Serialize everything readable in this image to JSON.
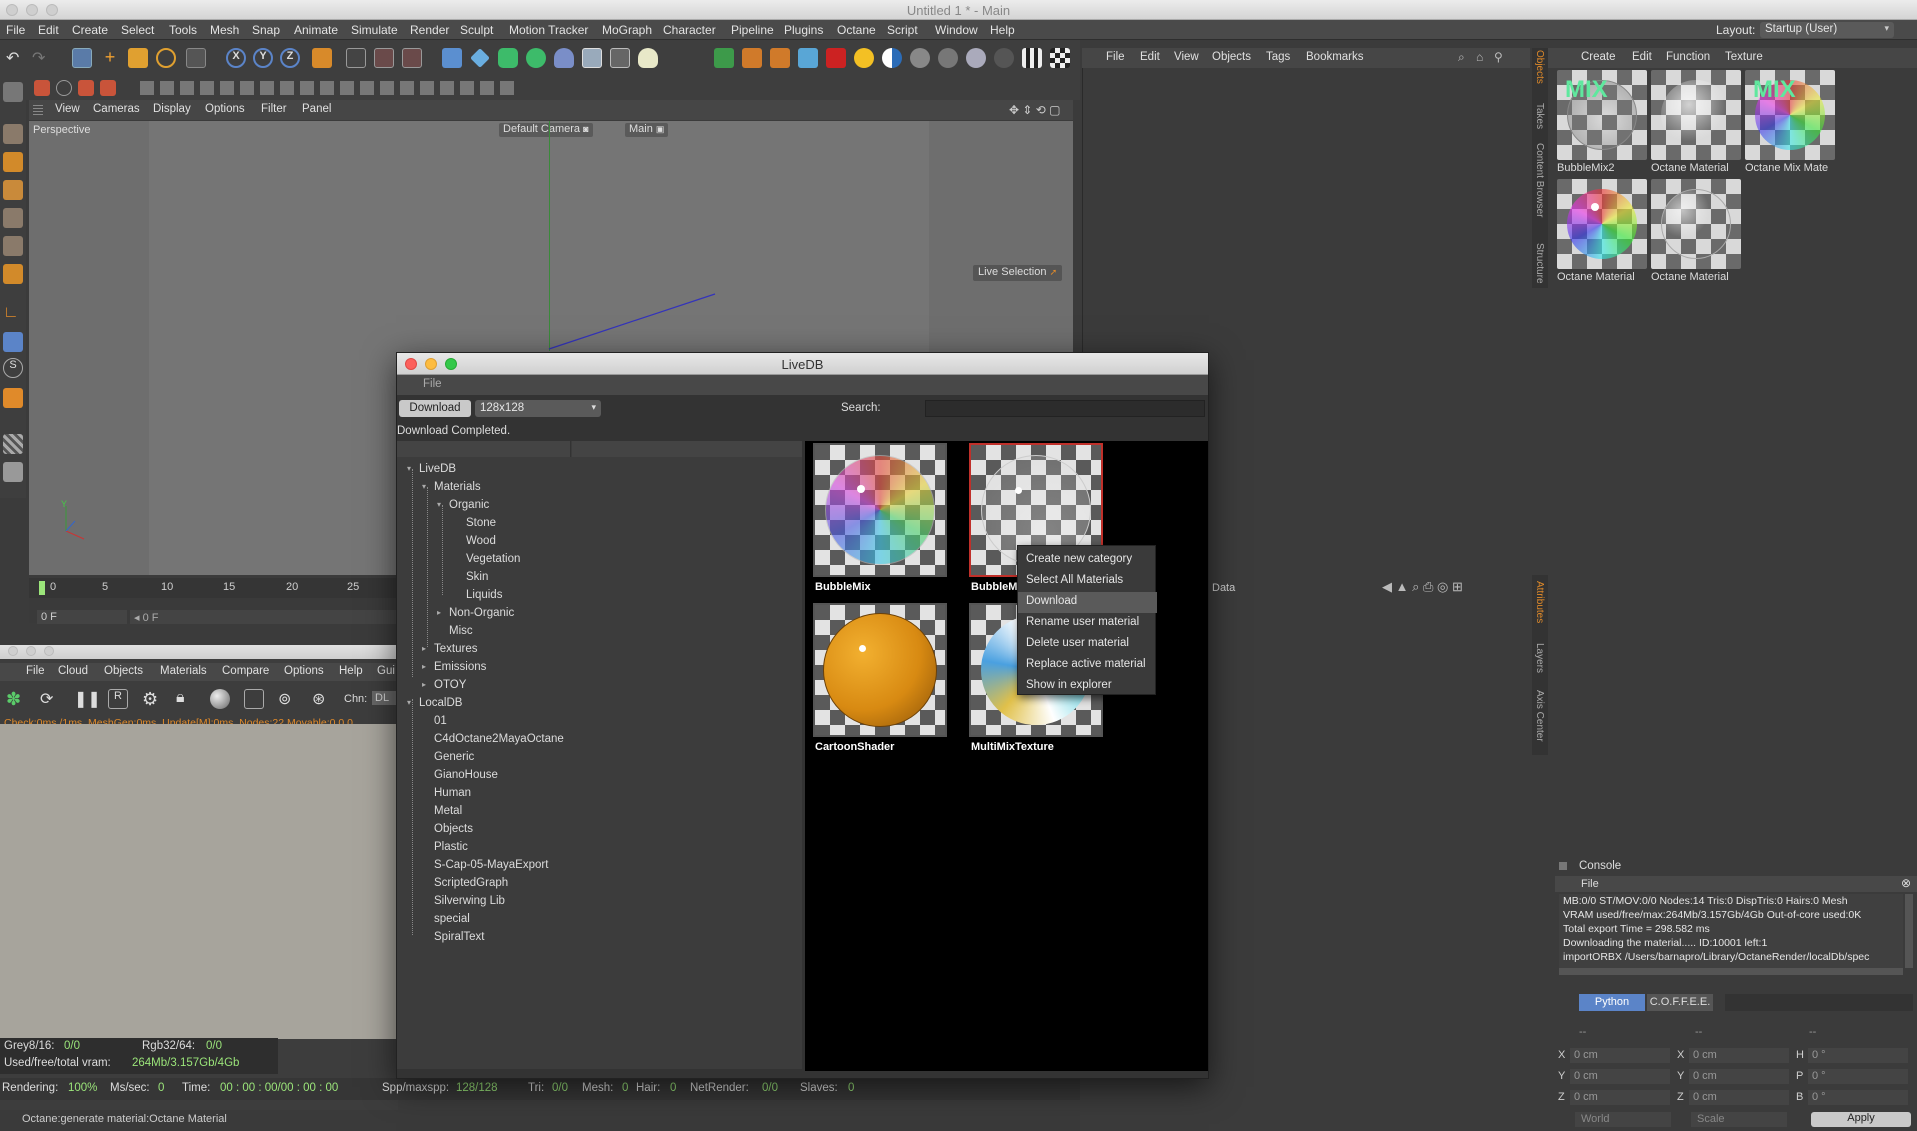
{
  "window": {
    "title": "Untitled 1 * - Main"
  },
  "menubar": [
    "File",
    "Edit",
    "Create",
    "Select",
    "Tools",
    "Mesh",
    "Snap",
    "Animate",
    "Simulate",
    "Render",
    "Sculpt",
    "Motion Tracker",
    "MoGraph",
    "Character",
    "Pipeline",
    "Plugins",
    "Octane",
    "Script",
    "Window",
    "Help"
  ],
  "layout": {
    "label": "Layout:",
    "value": "Startup (User)"
  },
  "viewport": {
    "menu": [
      "View",
      "Cameras",
      "Display",
      "Options",
      "Filter",
      "Panel"
    ],
    "perspective_label": "Perspective",
    "camera_label": "Default Camera",
    "main_label": "Main",
    "live_selection": "Live Selection"
  },
  "timeline": {
    "ticks": [
      "0",
      "5",
      "10",
      "15",
      "20",
      "25"
    ],
    "frame_value": "0 F",
    "frame_field2": "0 F",
    "texture_label": "Texture"
  },
  "object_manager": {
    "menu": [
      "File",
      "Edit",
      "View",
      "Objects",
      "Tags",
      "Bookmarks"
    ],
    "side_tabs": [
      "Objects",
      "Takes",
      "Content Browser",
      "Structure"
    ]
  },
  "material_manager": {
    "menu": [
      "Create",
      "Edit",
      "Function",
      "Texture"
    ],
    "materials": [
      {
        "name": "BubbleMix2",
        "mix": "MIX"
      },
      {
        "name": "Octane Material",
        "mix": ""
      },
      {
        "name": "Octane Mix Mate",
        "mix": "MIX"
      },
      {
        "name": "Octane Material",
        "mix": ""
      },
      {
        "name": "Octane Material",
        "mix": ""
      }
    ]
  },
  "attributes": {
    "data_label": "Data",
    "side_tabs": [
      "Attributes",
      "Layers",
      "Axis Center"
    ]
  },
  "console": {
    "title": "Console",
    "file_menu": "File",
    "lines": [
      "MB:0/0  ST/MOV:0/0  Nodes:14  Tris:0  DispTris:0  Hairs:0  Mesh",
      "VRAM used/free/max:264Mb/3.157Gb/4Gb  Out-of-core used:0K",
      "Total export Time = 298.582 ms",
      "Downloading the material..... ID:10001 left:1",
      "importORBX /Users/barnapro/Library/OctaneRender/localDb/spec"
    ],
    "tabs": [
      "Python",
      "C.O.F.F.E.E."
    ]
  },
  "coords": {
    "headers": [
      "--",
      "--",
      "--"
    ],
    "rows": [
      {
        "a": "X",
        "av": "0 cm",
        "b": "X",
        "bv": "0 cm",
        "c": "H",
        "cv": "0 °"
      },
      {
        "a": "Y",
        "av": "0 cm",
        "b": "Y",
        "bv": "0 cm",
        "c": "P",
        "cv": "0 °"
      },
      {
        "a": "Z",
        "av": "0 cm",
        "b": "Z",
        "bv": "0 cm",
        "c": "B",
        "cv": "0 °"
      }
    ],
    "world": "World",
    "scale": "Scale",
    "apply": "Apply"
  },
  "octane_window": {
    "menu": [
      "File",
      "Cloud",
      "Objects",
      "Materials",
      "Compare",
      "Options",
      "Help",
      "Gui"
    ],
    "chn_label": "Chn:",
    "chn_value": "DL",
    "status_line": "Check:0ms./1ms. MeshGen:0ms. Update[M]:0ms. Nodes:22 Movable:0  0 0",
    "grey_label": "Grey8/16:",
    "grey_value": "0/0",
    "rgb_label": "Rgb32/64:",
    "rgb_value": "0/0",
    "vram_label": "Used/free/total vram:",
    "vram_value": "264Mb/3.157Gb/4Gb"
  },
  "render_status": {
    "rendering_label": "Rendering:",
    "rendering_value": "100%",
    "ms_label": "Ms/sec:",
    "ms_value": "0",
    "time_label": "Time:",
    "time_value": "00 : 00 : 00/00 : 00 : 00",
    "spp_label": "Spp/maxspp:",
    "spp_value": "128/128",
    "tri_label": "Tri:",
    "tri_value": "0/0",
    "mesh_label": "Mesh:",
    "mesh_value": "0",
    "hair_label": "Hair:",
    "hair_value": "0",
    "net_label": "NetRender:",
    "net_value": "0/0",
    "slaves_label": "Slaves:",
    "slaves_value": "0"
  },
  "bottom_status": "Octane:generate material:Octane Material",
  "livedb": {
    "title": "LiveDB",
    "file_menu": "File",
    "download_button": "Download",
    "size_value": "128x128",
    "search_label": "Search:",
    "search_value": "",
    "status": "Download Completed.",
    "tree": [
      {
        "label": "LiveDB",
        "depth": 0
      },
      {
        "label": "Materials",
        "depth": 1
      },
      {
        "label": "Organic",
        "depth": 2
      },
      {
        "label": "Stone",
        "depth": 3
      },
      {
        "label": "Wood",
        "depth": 3
      },
      {
        "label": "Vegetation",
        "depth": 3
      },
      {
        "label": "Skin",
        "depth": 3
      },
      {
        "label": "Liquids",
        "depth": 3
      },
      {
        "label": "Non-Organic",
        "depth": 2
      },
      {
        "label": "Misc",
        "depth": 2
      },
      {
        "label": "Textures",
        "depth": 1
      },
      {
        "label": "Emissions",
        "depth": 1
      },
      {
        "label": "OTOY",
        "depth": 1
      },
      {
        "label": "LocalDB",
        "depth": 0
      },
      {
        "label": "01",
        "depth": 1
      },
      {
        "label": "C4dOctane2MayaOctane",
        "depth": 1
      },
      {
        "label": "Generic",
        "depth": 1
      },
      {
        "label": "GianoHouse",
        "depth": 1
      },
      {
        "label": "Human",
        "depth": 1
      },
      {
        "label": "Metal",
        "depth": 1
      },
      {
        "label": "Objects",
        "depth": 1
      },
      {
        "label": "Plastic",
        "depth": 1
      },
      {
        "label": "S-Cap-05-MayaExport",
        "depth": 1
      },
      {
        "label": "ScriptedGraph",
        "depth": 1
      },
      {
        "label": "Silverwing Lib",
        "depth": 1
      },
      {
        "label": "special",
        "depth": 1
      },
      {
        "label": "SpiralText",
        "depth": 1
      }
    ],
    "thumbnails": [
      "BubbleMix",
      "BubbleM",
      "CartoonShader",
      "MultiMixTexture"
    ],
    "context_menu": [
      "Create new category",
      "Select All Materials",
      "Download",
      "Rename user material",
      "Delete user material",
      "Replace active material",
      "Show in explorer"
    ],
    "context_highlight": "Download"
  },
  "colors": {
    "accent_green": "#9be57a",
    "selection_red": "#c0302a",
    "mix_green": "#5fe89e"
  }
}
